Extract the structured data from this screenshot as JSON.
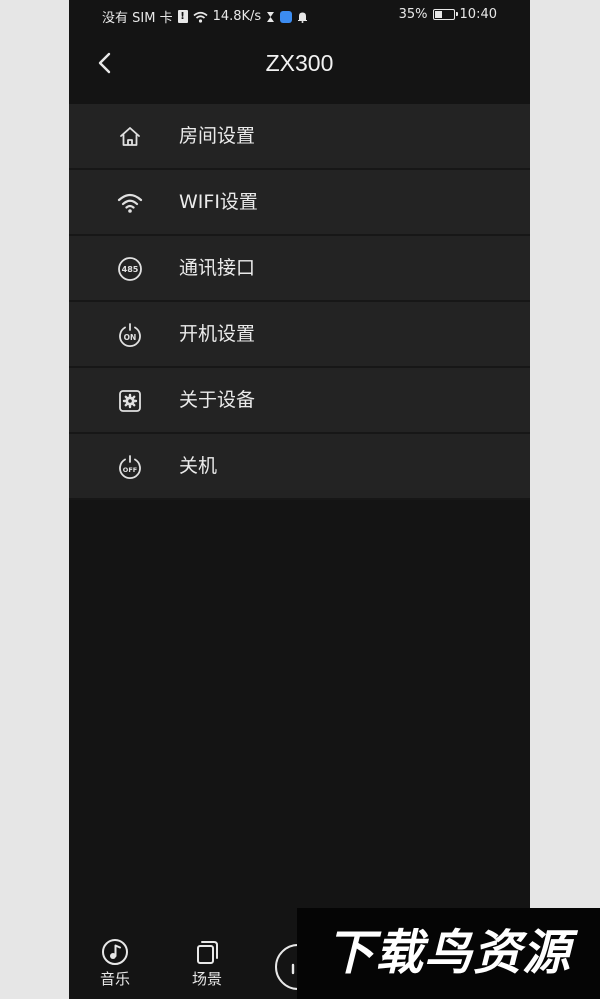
{
  "status_bar": {
    "carrier": "没有 SIM 卡",
    "warn_glyph": "!",
    "speed": "14.8K/s",
    "battery": "35%",
    "battery_level": 0.35,
    "time": "10:40"
  },
  "nav": {
    "title": "ZX300"
  },
  "menu": {
    "items": [
      {
        "label": "房间设置",
        "icon": "home-icon"
      },
      {
        "label": "WIFI设置",
        "icon": "wifi-icon"
      },
      {
        "label": "通讯接口",
        "icon": "rs485-icon",
        "icon_text": "485"
      },
      {
        "label": "开机设置",
        "icon": "power-on-icon",
        "icon_text": "ON"
      },
      {
        "label": "关于设备",
        "icon": "gear-icon"
      },
      {
        "label": "关机",
        "icon": "power-off-icon",
        "icon_text": "OFF"
      }
    ]
  },
  "tab_bar": {
    "tabs": [
      {
        "label": "音乐",
        "icon": "music-icon"
      },
      {
        "label": "场景",
        "icon": "scene-icon"
      },
      {
        "label": "",
        "icon": "audio-bars-icon"
      }
    ]
  },
  "watermark": {
    "text": "下载鸟资源"
  },
  "colors": {
    "background": "#141414",
    "menu_item": "#232323",
    "text": "#ebebeb"
  }
}
